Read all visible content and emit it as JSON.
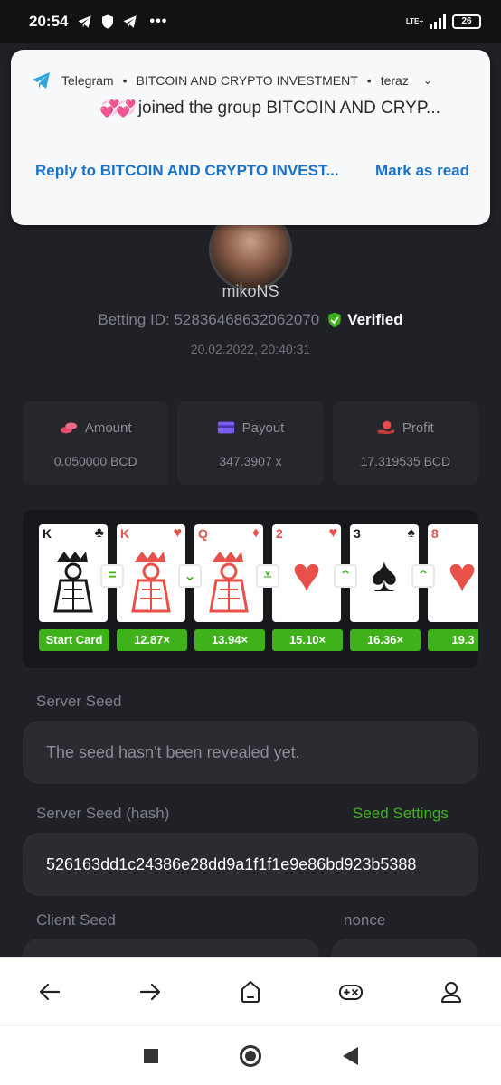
{
  "status_bar": {
    "time": "20:54",
    "network": "LTE+",
    "battery": "26"
  },
  "notification": {
    "app": "Telegram",
    "group": "BITCOIN AND CRYPTO INVESTMENT",
    "when": "teraz",
    "message": "joined the group BITCOIN AND CRYP...",
    "reply_label": "Reply to BITCOIN AND CRYPTO INVEST...",
    "mark_read_label": "Mark as read"
  },
  "bet": {
    "username": "mikoNS",
    "betting_id": "Betting ID: 52836468632062070",
    "verified_label": "Verified",
    "datetime": "20.02.2022, 20:40:31"
  },
  "stats": {
    "amount_label": "Amount",
    "amount_value": "0.050000 BCD",
    "payout_label": "Payout",
    "payout_value": "347.3907 x",
    "profit_label": "Profit",
    "profit_value": "17.319535 BCD"
  },
  "cards": [
    {
      "rank": "K",
      "suit": "♣",
      "color": "black",
      "face": true,
      "multiplier": "Start Card",
      "sep": "="
    },
    {
      "rank": "K",
      "suit": "♥",
      "color": "red",
      "face": true,
      "multiplier": "12.87×",
      "sep": "⌄"
    },
    {
      "rank": "Q",
      "suit": "♦",
      "color": "red",
      "face": true,
      "multiplier": "13.94×",
      "sep": "⩡"
    },
    {
      "rank": "2",
      "suit": "♥",
      "color": "red",
      "face": false,
      "multiplier": "15.10×",
      "sep": "⌃"
    },
    {
      "rank": "3",
      "suit": "♠",
      "color": "black",
      "face": false,
      "multiplier": "16.36×",
      "sep": "⌃"
    },
    {
      "rank": "8",
      "suit": "♥",
      "color": "red",
      "face": false,
      "multiplier": "19.3",
      "sep": ""
    }
  ],
  "seeds": {
    "server_seed_label": "Server Seed",
    "server_seed_value": "The seed hasn't been revealed yet.",
    "server_hash_label": "Server Seed (hash)",
    "seed_settings_label": "Seed Settings",
    "server_hash_value": "526163dd1c24386e28dd9a1f1f1e9e86bd923b5388",
    "client_seed_label": "Client Seed",
    "nonce_label": "nonce"
  },
  "colors": {
    "accent": "#3fb21b",
    "bg": "#1f2126",
    "card_red": "#e8504a"
  }
}
